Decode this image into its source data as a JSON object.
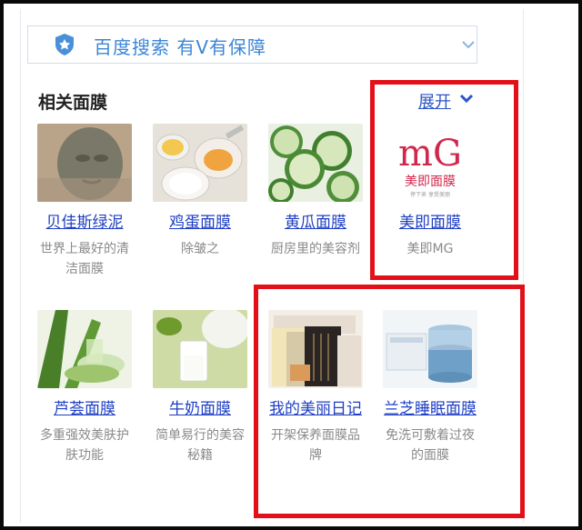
{
  "banner": {
    "text": "百度搜索  有V有保障",
    "icon": "shield-icon"
  },
  "section": {
    "title": "相关面膜",
    "expand_label": "展开"
  },
  "colors": {
    "link": "#1f3fc4",
    "highlight": "#e3101a",
    "banner_text": "#3b86d6"
  },
  "cards": [
    {
      "name": "贝佳斯绿泥",
      "desc": "世界上最好的清洁面膜"
    },
    {
      "name": "鸡蛋面膜",
      "desc": "除皱之"
    },
    {
      "name": "黄瓜面膜",
      "desc": "厨房里的美容剂"
    },
    {
      "name": "美即面膜",
      "desc": "美即MG",
      "logo_text": "mG",
      "logo_sub": "美即面膜",
      "logo_tagline": "停下来 享受美丽"
    },
    {
      "name": "芦荟面膜",
      "desc": "多重强效美肤护肤功能"
    },
    {
      "name": "牛奶面膜",
      "desc": "简单易行的美容秘籍"
    },
    {
      "name": "我的美丽日记",
      "desc": "开架保养面膜品牌"
    },
    {
      "name": "兰芝睡眠面膜",
      "desc": "免洗可敷着过夜的面膜"
    }
  ]
}
